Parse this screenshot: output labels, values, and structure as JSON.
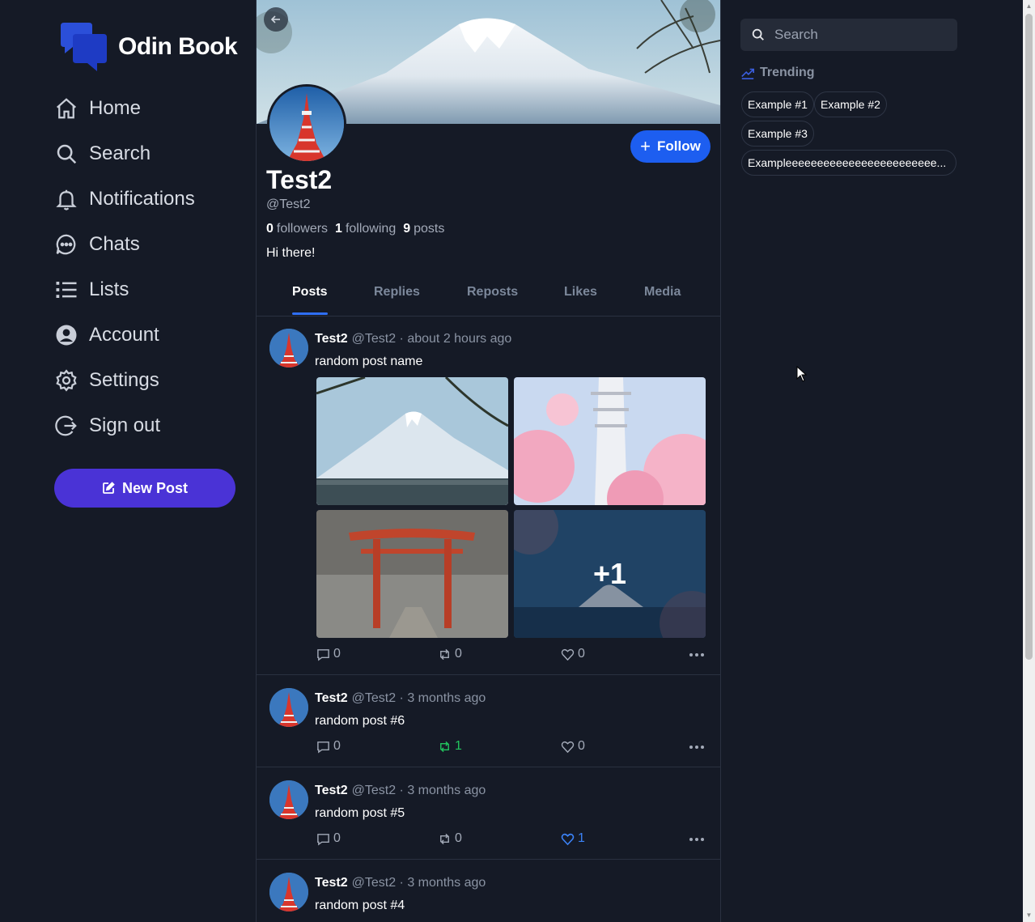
{
  "app": {
    "name": "Odin Book"
  },
  "nav": {
    "items": [
      {
        "label": "Home",
        "icon": "home-icon"
      },
      {
        "label": "Search",
        "icon": "search-icon"
      },
      {
        "label": "Notifications",
        "icon": "bell-icon"
      },
      {
        "label": "Chats",
        "icon": "chat-icon"
      },
      {
        "label": "Lists",
        "icon": "list-icon"
      },
      {
        "label": "Account",
        "icon": "user-circle-icon"
      },
      {
        "label": "Settings",
        "icon": "gear-icon"
      },
      {
        "label": "Sign out",
        "icon": "sign-out-icon"
      }
    ],
    "new_post_label": "New Post"
  },
  "profile": {
    "name": "Test2",
    "handle": "@Test2",
    "follow_label": "Follow",
    "followers_count": "0",
    "followers_label": "followers",
    "following_count": "1",
    "following_label": "following",
    "posts_count": "9",
    "posts_label": "posts",
    "bio": "Hi there!"
  },
  "tabs": [
    {
      "label": "Posts",
      "active": true
    },
    {
      "label": "Replies",
      "active": false
    },
    {
      "label": "Reposts",
      "active": false
    },
    {
      "label": "Likes",
      "active": false
    },
    {
      "label": "Media",
      "active": false
    }
  ],
  "posts": [
    {
      "name": "Test2",
      "handle": "@Test2",
      "sep": "·",
      "time": "about 2 hours ago",
      "text": "random post name",
      "comments": "0",
      "reposts": "0",
      "likes": "0",
      "extra_images": "+1"
    },
    {
      "name": "Test2",
      "handle": "@Test2",
      "sep": "·",
      "time": "3 months ago",
      "text": "random post #6",
      "comments": "0",
      "reposts": "1",
      "likes": "0"
    },
    {
      "name": "Test2",
      "handle": "@Test2",
      "sep": "·",
      "time": "3 months ago",
      "text": "random post #5",
      "comments": "0",
      "reposts": "0",
      "likes": "1"
    },
    {
      "name": "Test2",
      "handle": "@Test2",
      "sep": "·",
      "time": "3 months ago",
      "text": "random post #4"
    }
  ],
  "right": {
    "search_placeholder": "Search",
    "trending_title": "Trending",
    "trending": [
      "Example #1",
      "Example #2",
      "Example #3",
      "Exampleeeeeeeeeeeeeeeeeeeeeeee..."
    ]
  },
  "colors": {
    "background": "#151a26",
    "accent_blue": "#1d5ef0",
    "new_post_purple": "#4a33d6",
    "repost_green": "#22c55e",
    "like_blue": "#3b82f6"
  }
}
